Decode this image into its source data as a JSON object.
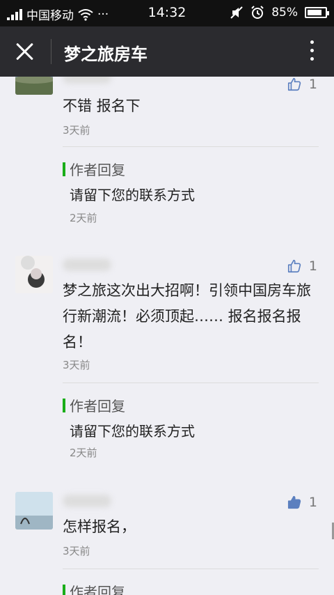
{
  "status_bar": {
    "carrier": "中国移动",
    "dots": "···",
    "time": "14:32",
    "battery": "85%",
    "battery_level": 0.85
  },
  "nav": {
    "title": "梦之旅房车"
  },
  "comments": [
    {
      "text": "不错 报名下",
      "time": "3天前",
      "likes": "1",
      "liked": false,
      "reply": {
        "label": "作者回复",
        "text": "请留下您的联系方式",
        "time": "2天前"
      }
    },
    {
      "text": "梦之旅这次出大招啊！引领中国房车旅行新潮流！必须顶起…… 报名报名报名！",
      "time": "3天前",
      "likes": "1",
      "liked": false,
      "reply": {
        "label": "作者回复",
        "text": "请留下您的联系方式",
        "time": "2天前"
      }
    },
    {
      "text": "怎样报名，",
      "time": "3天前",
      "likes": "1",
      "liked": true,
      "reply": {
        "label": "作者回复"
      }
    }
  ],
  "colors": {
    "accent": "#1aad19",
    "like_blue": "#5b7fbf"
  }
}
